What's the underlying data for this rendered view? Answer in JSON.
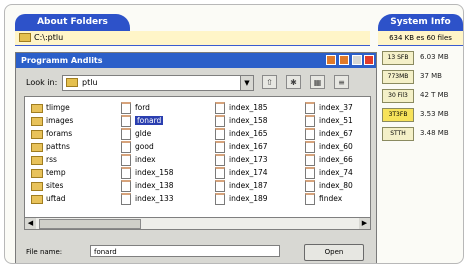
{
  "tabs": {
    "left": "About Folders",
    "right": "System Info"
  },
  "path": "C:\\:ptlu",
  "system": {
    "header": "634 KB es 60 files",
    "rows": [
      {
        "chip": "13 SFB",
        "value": "6.03 MB"
      },
      {
        "chip": "773MB",
        "value": "37 MB"
      },
      {
        "chip": "30 Fil3",
        "value": "42 T MB"
      },
      {
        "chip": "3T3FB",
        "value": "3.53 MB"
      },
      {
        "chip": "STTH",
        "value": "3.48 MB"
      }
    ]
  },
  "dialog": {
    "title": "Programm Andlits",
    "look_in_label": "Look in:",
    "look_in_value": "ptlu",
    "toolbar_glyphs": [
      "⇧",
      "✱",
      "▦",
      "≡"
    ],
    "columns": [
      [
        {
          "kind": "folder",
          "label": "tlimge"
        },
        {
          "kind": "folder",
          "label": "images"
        },
        {
          "kind": "folder",
          "label": "forams"
        },
        {
          "kind": "folder",
          "label": "pattns"
        },
        {
          "kind": "folder",
          "label": "rss"
        },
        {
          "kind": "folder",
          "label": "temp"
        },
        {
          "kind": "folder",
          "label": "sites"
        },
        {
          "kind": "folder",
          "label": "uftad"
        }
      ],
      [
        {
          "kind": "file",
          "label": "ford"
        },
        {
          "kind": "file",
          "label": "fonard",
          "selected": true
        },
        {
          "kind": "file",
          "label": "glde"
        },
        {
          "kind": "file",
          "label": "good"
        },
        {
          "kind": "file",
          "label": "index"
        },
        {
          "kind": "file",
          "label": "index_158"
        },
        {
          "kind": "file",
          "label": "index_138"
        },
        {
          "kind": "file",
          "label": "index_133"
        }
      ],
      [
        {
          "kind": "file",
          "label": "index_185"
        },
        {
          "kind": "file",
          "label": "index_158"
        },
        {
          "kind": "file",
          "label": "index_165"
        },
        {
          "kind": "file",
          "label": "index_167"
        },
        {
          "kind": "file",
          "label": "index_173"
        },
        {
          "kind": "file",
          "label": "index_174"
        },
        {
          "kind": "file",
          "label": "index_187"
        },
        {
          "kind": "file",
          "label": "index_189"
        }
      ],
      [
        {
          "kind": "file",
          "label": "index_37"
        },
        {
          "kind": "file",
          "label": "index_51"
        },
        {
          "kind": "file",
          "label": "index_67"
        },
        {
          "kind": "file",
          "label": "index_60"
        },
        {
          "kind": "file",
          "label": "index_66"
        },
        {
          "kind": "file",
          "label": "index_74"
        },
        {
          "kind": "file",
          "label": "index_80"
        },
        {
          "kind": "file",
          "label": "findex"
        }
      ]
    ],
    "filename_label": "File name:",
    "filename_value": "fonard",
    "save_label": "Open"
  }
}
